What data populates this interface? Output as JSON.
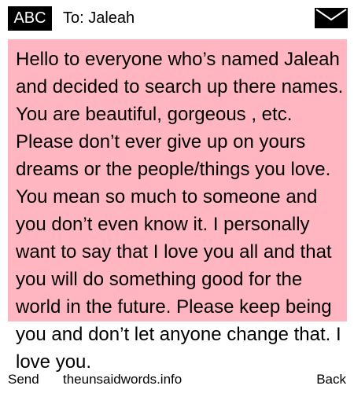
{
  "header": {
    "input_mode": "ABC",
    "recipient": "To: Jaleah",
    "icon": "envelope-icon"
  },
  "message": {
    "text": "Hello to everyone who’s named Jaleah and decided to search up there names. You are beautiful, gorgeous , etc. Please don’t ever give up on yours dreams or the people/things you love. You mean so much to someone and you don’t even know it. I personally want to say that I love you all and that you will do something good for the world in the future. Please keep being you and don’t let anyone change that. I love you."
  },
  "footer": {
    "send_label": "Send",
    "site_label": "theunsaidwords.info",
    "back_label": "Back"
  },
  "colors": {
    "message_background": "#ffb6c1",
    "badge_background": "#000000",
    "page_background": "#ffffff"
  }
}
